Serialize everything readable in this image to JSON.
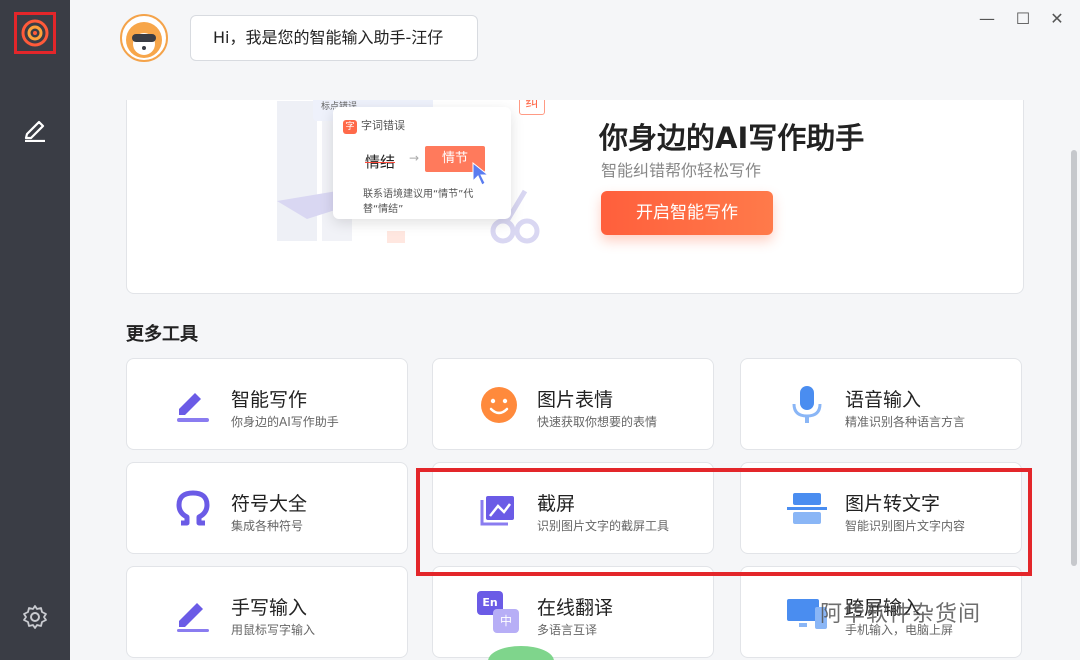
{
  "header": {
    "greeting": "Hi，我是您的智能输入助手-汪仔",
    "window_controls": [
      "minimize",
      "maximize",
      "close"
    ]
  },
  "sidebar": {
    "items": [
      {
        "name": "logo",
        "icon": "target-logo-icon",
        "selected": true
      },
      {
        "name": "writing",
        "icon": "pen-icon"
      },
      {
        "name": "settings",
        "icon": "gear-icon"
      }
    ]
  },
  "hero": {
    "title": "你身边的AI写作助手",
    "subtitle": "智能纠错帮你轻松写作",
    "button": "开启智能写作",
    "illustration": {
      "tag": "字词错误",
      "tag_badge": "字",
      "back_tag": "标点错误",
      "wrong_word": "情结",
      "right_word": "情节",
      "note": "联系语境建议用“情节”代替“情结”",
      "corner_char": "纠"
    }
  },
  "more_tools": {
    "title": "更多工具",
    "tools": [
      {
        "name": "智能写作",
        "desc": "你身边的AI写作助手",
        "icon": "write-icon"
      },
      {
        "name": "图片表情",
        "desc": "快速获取你想要的表情",
        "icon": "smiley-icon"
      },
      {
        "name": "语音输入",
        "desc": "精准识别各种语言方言",
        "icon": "microphone-icon"
      },
      {
        "name": "符号大全",
        "desc": "集成各种符号",
        "icon": "omega-icon"
      },
      {
        "name": "截屏",
        "desc": "识别图片文字的截屏工具",
        "icon": "screenshot-icon"
      },
      {
        "name": "图片转文字",
        "desc": "智能识别图片文字内容",
        "icon": "ocr-icon"
      },
      {
        "name": "手写输入",
        "desc": "用鼠标写字输入",
        "icon": "handwrite-icon"
      },
      {
        "name": "在线翻译",
        "desc": "多语言互译",
        "icon": "translate-icon",
        "icon_text": [
          "En",
          "中"
        ]
      },
      {
        "name": "跨屏输入",
        "desc": "手机输入，电脑上屏",
        "icon": "cross-screen-icon"
      }
    ]
  },
  "watermark": "阿华软件杂货间",
  "colors": {
    "accent": "#ff6a3c",
    "sidebar_bg": "#3a3d45",
    "icon_purple": "#6b5be6",
    "icon_blue": "#4a8df0",
    "highlight_red": "#e3262a"
  }
}
